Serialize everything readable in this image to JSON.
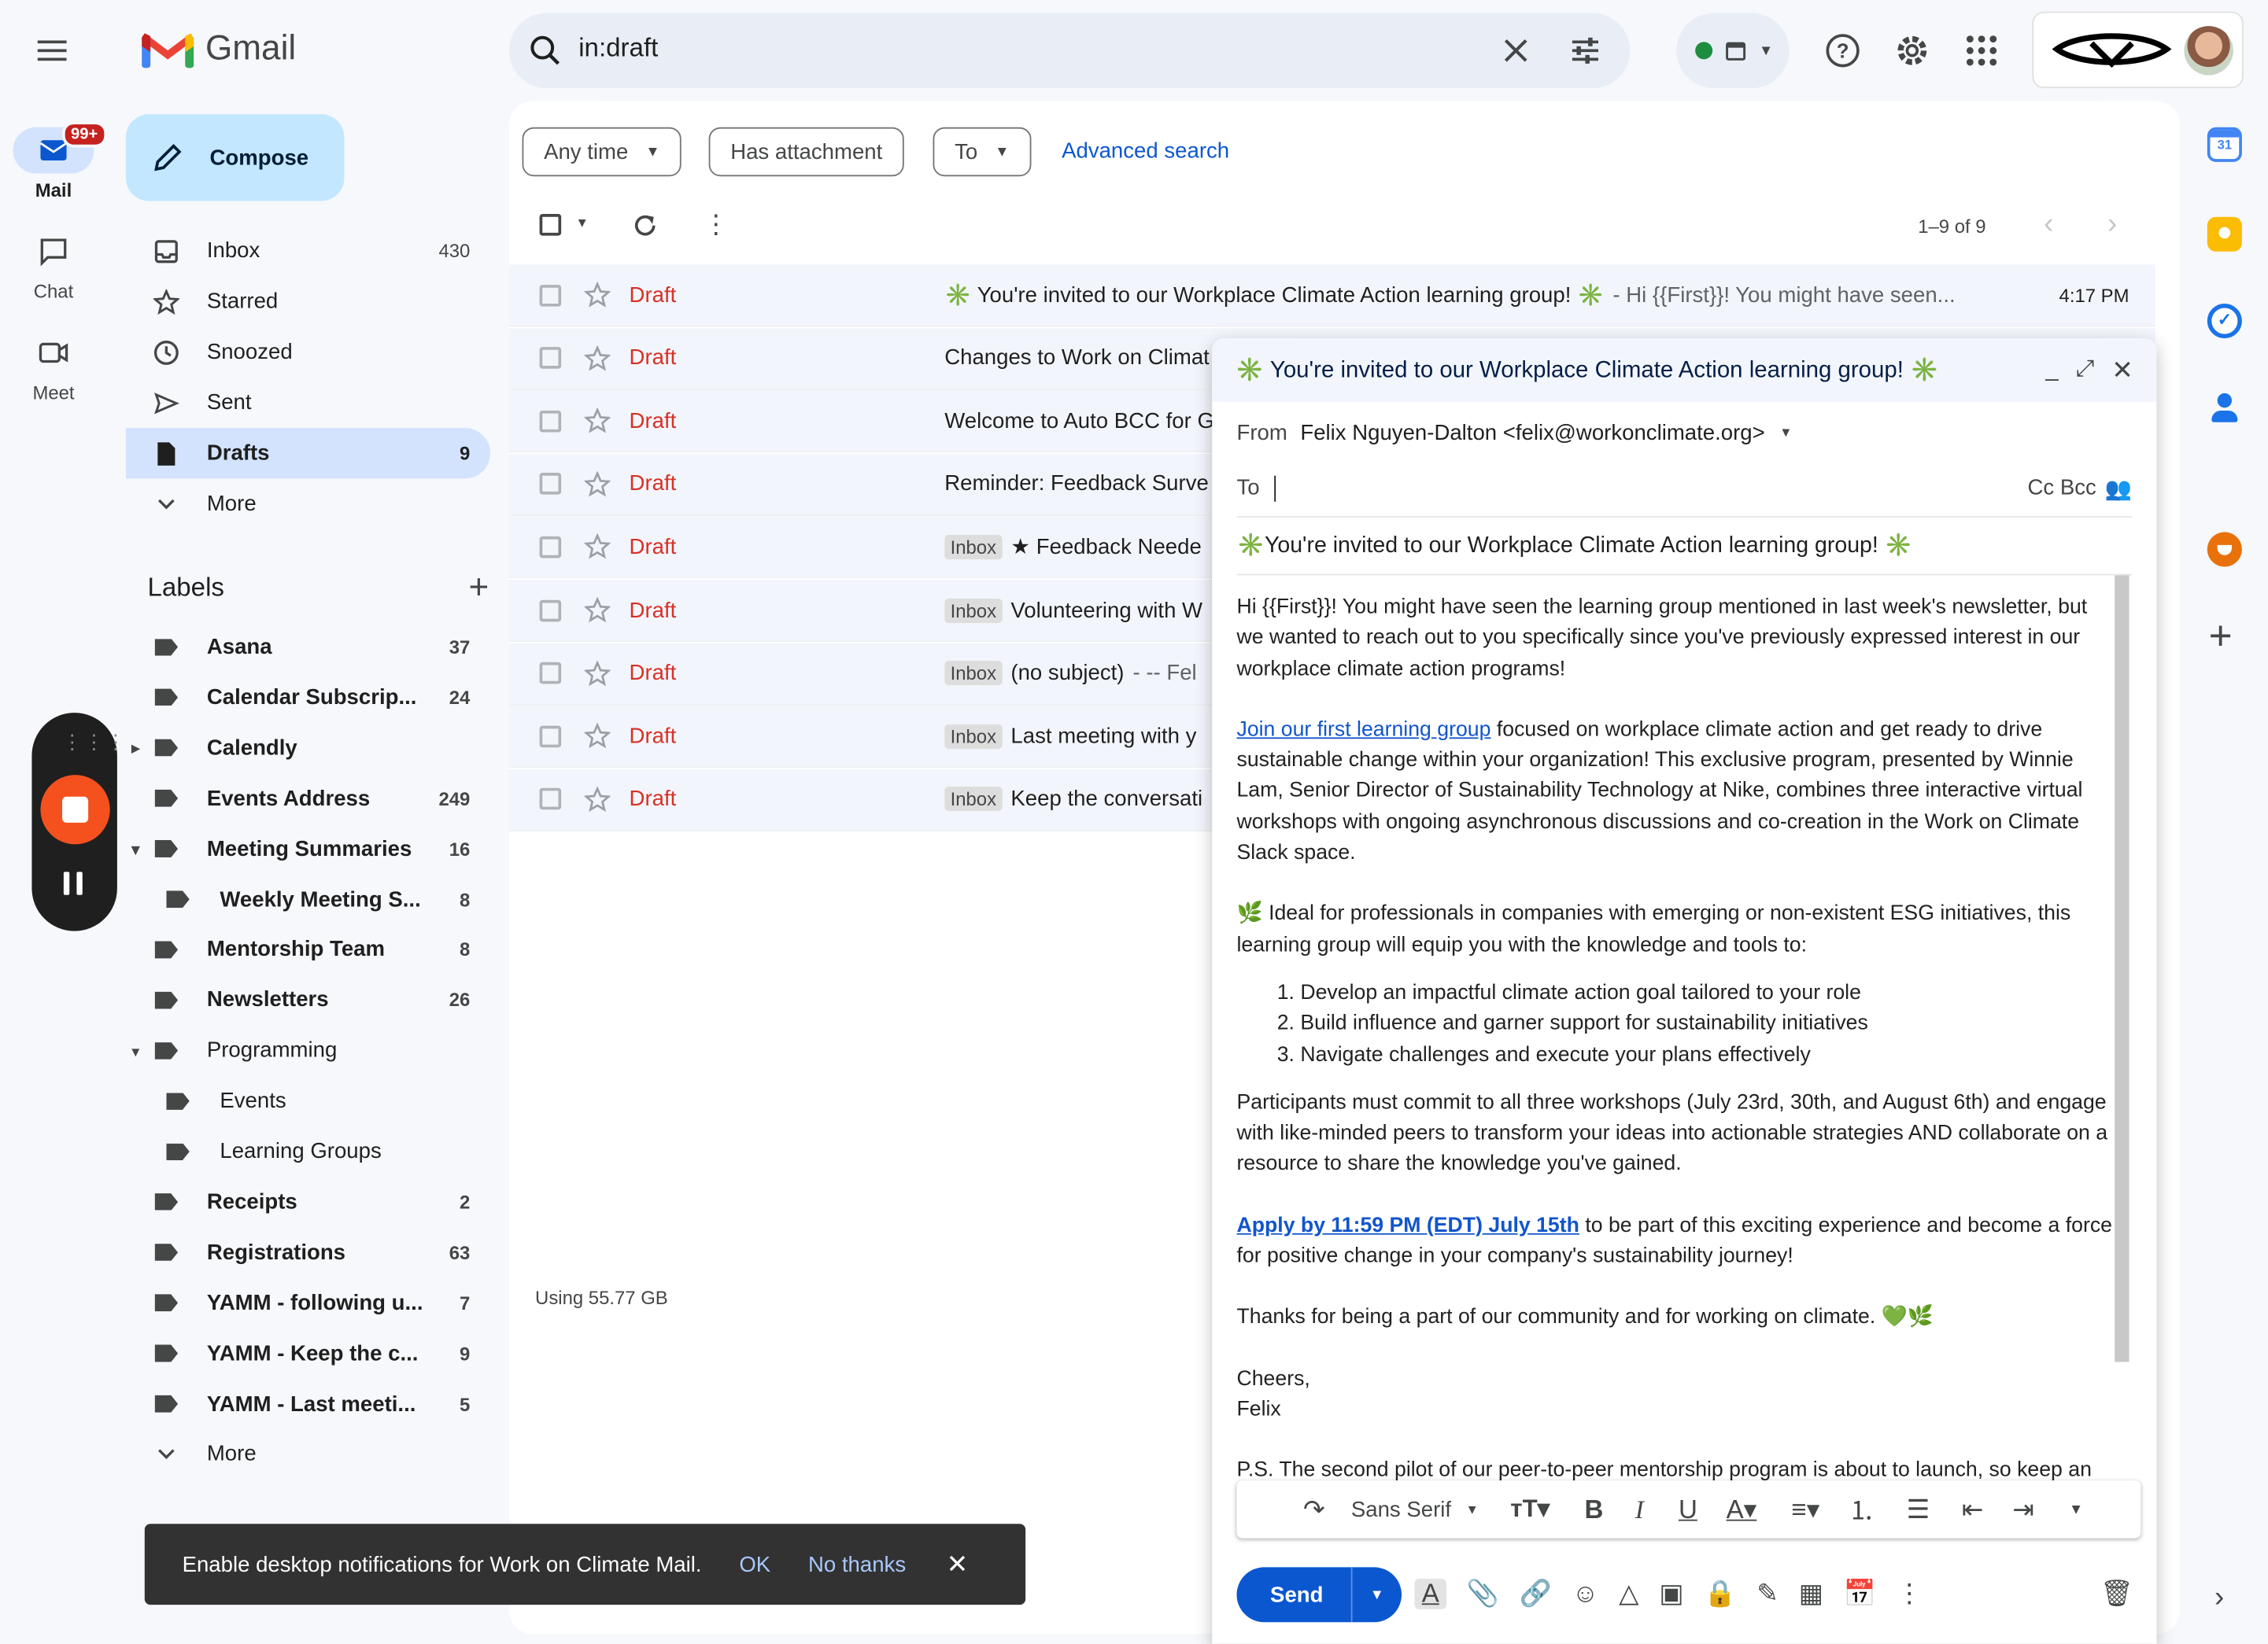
{
  "app": {
    "name": "Gmail"
  },
  "rail": {
    "mail_label": "Mail",
    "mail_badge": "99+",
    "chat_label": "Chat",
    "meet_label": "Meet"
  },
  "compose_button": "Compose",
  "nav": [
    {
      "label": "Inbox",
      "count": "430",
      "icon": "inbox-icon"
    },
    {
      "label": "Starred",
      "count": "",
      "icon": "star-icon"
    },
    {
      "label": "Snoozed",
      "count": "",
      "icon": "clock-icon"
    },
    {
      "label": "Sent",
      "count": "",
      "icon": "send-icon"
    },
    {
      "label": "Drafts",
      "count": "9",
      "icon": "draft-icon"
    },
    {
      "label": "More",
      "count": "",
      "icon": "chevron-down-icon"
    }
  ],
  "labels_title": "Labels",
  "labels": [
    {
      "label": "Asana",
      "count": "37"
    },
    {
      "label": "Calendar Subscrip...",
      "count": "24"
    },
    {
      "label": "Calendly",
      "count": ""
    },
    {
      "label": "Events Address",
      "count": "249"
    },
    {
      "label": "Meeting Summaries",
      "count": "16"
    },
    {
      "label": "Weekly Meeting S...",
      "count": "8"
    },
    {
      "label": "Mentorship Team",
      "count": "8"
    },
    {
      "label": "Newsletters",
      "count": "26"
    },
    {
      "label": "Programming",
      "count": ""
    },
    {
      "label": "Events",
      "count": ""
    },
    {
      "label": "Learning Groups",
      "count": ""
    },
    {
      "label": "Receipts",
      "count": "2"
    },
    {
      "label": "Registrations",
      "count": "63"
    },
    {
      "label": "YAMM - following u...",
      "count": "7"
    },
    {
      "label": "YAMM - Keep the c...",
      "count": "9"
    },
    {
      "label": "YAMM - Last meeti...",
      "count": "5"
    }
  ],
  "labels_more": "More",
  "search": {
    "query": "in:draft"
  },
  "filters": {
    "any_time": "Any time",
    "has_attachment": "Has attachment",
    "to": "To",
    "advanced": "Advanced search"
  },
  "pagination": "1–9 of 9",
  "rows": [
    {
      "status": "Draft",
      "inbox": "",
      "subject": "✳️ You're invited to our Workplace Climate Action learning group! ✳️",
      "snippet": " - Hi {{First}}! You might have seen...",
      "time": "4:17 PM"
    },
    {
      "status": "Draft",
      "inbox": "",
      "subject": "Changes to Work on Climat",
      "snippet": "",
      "time": ""
    },
    {
      "status": "Draft",
      "inbox": "",
      "subject": "Welcome to Auto BCC for G",
      "snippet": "",
      "time": ""
    },
    {
      "status": "Draft",
      "inbox": "",
      "subject": "Reminder: Feedback Surve",
      "snippet": "",
      "time": ""
    },
    {
      "status": "Draft",
      "inbox": "Inbox",
      "subject": "★ Feedback Neede",
      "snippet": "",
      "time": ""
    },
    {
      "status": "Draft",
      "inbox": "Inbox",
      "subject": "Volunteering with W",
      "snippet": "",
      "time": ""
    },
    {
      "status": "Draft",
      "inbox": "Inbox",
      "subject": "(no subject)",
      "snippet": " - -- Fel",
      "time": ""
    },
    {
      "status": "Draft",
      "inbox": "Inbox",
      "subject": "Last meeting with y",
      "snippet": "",
      "time": ""
    },
    {
      "status": "Draft",
      "inbox": "Inbox",
      "subject": "Keep the conversati",
      "snippet": "",
      "time": ""
    }
  ],
  "storage": "Using 55.77 GB",
  "compose_window": {
    "title": "✳️ You're invited to our Workplace Climate Action learning group! ✳️",
    "from_label": "From",
    "from_value": "Felix Nguyen-Dalton <felix@workonclimate.org>",
    "to_label": "To",
    "cc_bcc": "Cc Bcc",
    "subject": "✳️You're invited to our Workplace Climate Action learning group! ✳️",
    "body": {
      "p1": "Hi {{First}}! You might have seen the learning group mentioned in last week's newsletter, but we wanted to reach out to you specifically since you've previously expressed interest in our workplace climate action programs!",
      "p2_link": "Join our first learning group",
      "p2": " focused on workplace climate action and get ready to drive sustainable change within your organization! This exclusive program, presented by Winnie Lam, Senior Director of Sustainability Technology at Nike, combines three interactive virtual workshops with ongoing asynchronous discussions and co-creation in the Work on Climate Slack space.",
      "p3": "🌿 Ideal for professionals in companies with emerging or non-existent ESG initiatives, this learning group will equip you with the knowledge and tools to:",
      "list": [
        "Develop an impactful climate action goal tailored to your role",
        "Build influence and garner support for sustainability initiatives",
        "Navigate challenges and execute your plans effectively"
      ],
      "p4": "Participants must commit to all three workshops (July 23rd, 30th, and August 6th) and engage with like-minded peers to transform your ideas into actionable strategies AND collaborate on a resource to share the knowledge you've gained.",
      "p5_link": "Apply by 11:59 PM (EDT) July 15th",
      "p5": " to be part of this exciting experience and become a force for positive change in your company's sustainability journey!",
      "p6": "Thanks for being a part of our community and for working on climate. 💚🌿",
      "p7a": "Cheers,",
      "p7b": "Felix",
      "p8": "P.S. The second pilot of our peer-to-peer mentorship program is about to launch, so keep an"
    },
    "font": "Sans Serif",
    "send": "Send"
  },
  "snackbar": {
    "text": "Enable desktop notifications for Work on Climate Mail.",
    "ok": "OK",
    "no": "No thanks"
  },
  "colors": {
    "accent": "#0b57d0",
    "draft": "#d93025",
    "compose_bg": "#c2e7ff",
    "active_nav": "#d3e3fd"
  }
}
